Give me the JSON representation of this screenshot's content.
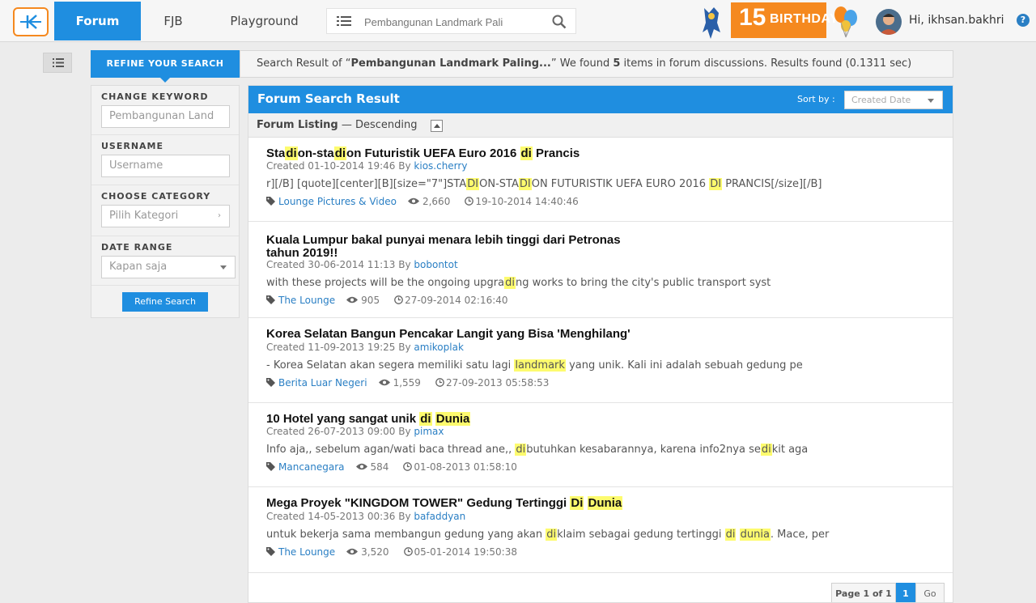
{
  "nav": {
    "tabs": [
      {
        "label": "Forum",
        "active": true
      },
      {
        "label": "FJB",
        "active": false
      },
      {
        "label": "Playground",
        "active": false
      }
    ],
    "search_value": "Pembangunan Landmark Pali",
    "birthday_number": "15",
    "birthday_word": "BIRTHDAY",
    "greeting": "Hi, ikhsan.bakhri",
    "help": "?"
  },
  "sidebar": {
    "refine_tab": "REFINE YOUR SEARCH",
    "keyword_label": "CHANGE KEYWORD",
    "keyword_value": "Pembangunan Land",
    "username_label": "USERNAME",
    "username_placeholder": "Username",
    "category_label": "CHOOSE CATEGORY",
    "category_value": "Pilih Kategori",
    "date_label": "DATE RANGE",
    "date_value": "Kapan saja",
    "refine_button": "Refine Search"
  },
  "summary": {
    "prefix": "Search Result of “",
    "query": "Pembangunan Landmark Paling...",
    "middle": "” We found ",
    "count": "5",
    "suffix": " items in forum discussions. Results found (0.1311 sec)"
  },
  "results": {
    "title": "Forum Search Result",
    "sort_label": "Sort by :",
    "sort_value": "Created Date",
    "listing_label": "Forum Listing",
    "listing_order": " — Descending",
    "items": [
      {
        "title": "Sta<span class=\"hl\">di</span>on-sta<span class=\"hl\">di</span>on Futuristik UEFA Euro 2016 <span class=\"hl\">di</span> Prancis",
        "created": "Created 01-10-2014 19:46 By ",
        "author": "kios.cherry",
        "snippet": "r][/B] [quote][center][B][size=\"7\"]STA<span class=\"hl\">DI</span>ON-STA<span class=\"hl\">DI</span>ON FUTURISTIK UEFA EURO 2016 <span class=\"hl\">DI</span> PRANCIS[/size][/B]",
        "category": "Lounge Pictures & Video",
        "views": "2,660",
        "last": "19-10-2014 14:40:46"
      },
      {
        "title": "Kuala Lumpur bakal punyai menara lebih tinggi dari Petronas<br>tahun 2019!!",
        "created": "Created 30-06-2014 11:13 By ",
        "author": "bobontot",
        "snippet": "with these projects will be the ongoing upgra<span class=\"hl\">di</span>ng works to bring the city's public transport syst",
        "category": "The Lounge",
        "views": "905",
        "last": "27-09-2014 02:16:40"
      },
      {
        "title": "Korea Selatan Bangun Pencakar Langit yang Bisa 'Menghilang'",
        "created": "Created 11-09-2013 19:25 By ",
        "author": "amikoplak",
        "snippet": "- Korea Selatan akan segera memiliki satu lagi <span class=\"hl\">landmark</span> yang unik. Kali ini adalah sebuah gedung pe",
        "category": "Berita Luar Negeri",
        "views": "1,559",
        "last": "27-09-2013 05:58:53"
      },
      {
        "title": "10 Hotel yang sangat unik <span class=\"hl\">di</span> <span class=\"hl\">Dunia</span>",
        "created": "Created 26-07-2013 09:00 By ",
        "author": "pimax",
        "snippet": "Info aja,, sebelum agan/wati baca thread ane,, <span class=\"hl\">di</span>butuhkan kesabarannya, karena info2nya se<span class=\"hl\">di</span>kit aga",
        "category": "Mancanegara",
        "views": "584",
        "last": "01-08-2013 01:58:10"
      },
      {
        "title": "Mega Proyek \"KINGDOM TOWER\" Gedung Tertinggi <span class=\"hl\">Di</span> <span class=\"hl\">Dunia</span>",
        "created": "Created 14-05-2013 00:36 By ",
        "author": "bafaddyan",
        "snippet": "untuk bekerja sama membangun gedung yang akan <span class=\"hl\">di</span>klaim sebagai gedung tertinggi <span class=\"hl\">di</span> <span class=\"hl\">dunia</span>. Mace, per",
        "category": "The Lounge",
        "views": "3,520",
        "last": "05-01-2014 19:50:38"
      }
    ],
    "pager_label": "Page 1 of 1",
    "pager_current": "1",
    "pager_go": "Go"
  },
  "colors": {
    "accent": "#1f8ee0",
    "brand_orange": "#f5891f",
    "highlight": "#fdfb6e"
  }
}
